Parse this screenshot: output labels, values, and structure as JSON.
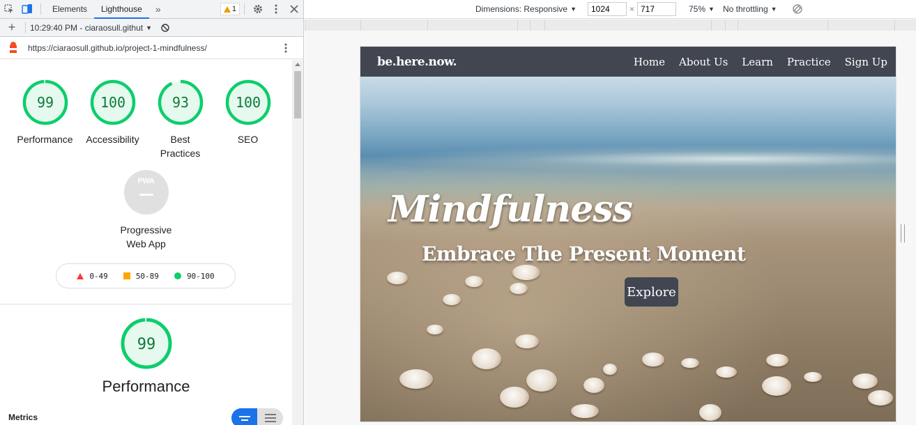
{
  "devtools": {
    "tabs": {
      "elements": "Elements",
      "lighthouse": "Lighthouse"
    },
    "warnings_count": "1",
    "report_selector": "10:29:40 PM - ciaraosull.githut",
    "url": "https://ciaraosull.github.io/project-1-mindfulness/",
    "scores": [
      {
        "label": "Performance",
        "value": "99",
        "score": 0.99
      },
      {
        "label": "Accessibility",
        "value": "100",
        "score": 1.0
      },
      {
        "label": "Best Practices",
        "value": "93",
        "score": 0.93
      },
      {
        "label": "SEO",
        "value": "100",
        "score": 1.0
      }
    ],
    "pwa": {
      "badge": "PWA",
      "label": "Progressive Web App"
    },
    "legend": {
      "low": "0-49",
      "mid": "50-89",
      "high": "90-100"
    },
    "performance": {
      "value": "99",
      "score": 0.99,
      "title": "Performance"
    },
    "metrics_label": "Metrics",
    "colors": {
      "pass": "#0cce6b",
      "pass_text": "#0c7a3a",
      "average": "#ffa400",
      "fail": "#ff3333",
      "accent": "#1a73e8"
    }
  },
  "emulation": {
    "dimensions_label": "Dimensions: Responsive",
    "width": "1024",
    "times": "×",
    "height": "717",
    "zoom": "75%",
    "throttling": "No throttling"
  },
  "site": {
    "brand": "be.here.now.",
    "nav": [
      "Home",
      "About Us",
      "Learn",
      "Practice",
      "Sign Up"
    ],
    "hero_title": "Mindfulness",
    "hero_subtitle": "Embrace The Present Moment",
    "cta": "Explore",
    "colors": {
      "nav_bg": "#414651"
    }
  }
}
